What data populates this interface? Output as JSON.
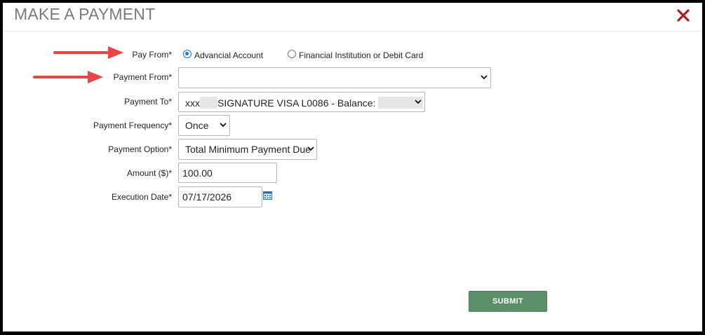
{
  "dialog": {
    "title": "MAKE A PAYMENT",
    "close_icon": "close-x-icon",
    "colors": {
      "close": "#b01c1c",
      "arrow": "#e84545",
      "radio_accent": "#1a73e8",
      "submit": "#5a8f6a"
    }
  },
  "form": {
    "pay_from": {
      "label": "Pay From*",
      "options": [
        {
          "label": "Advancial Account",
          "checked": true
        },
        {
          "label": "Financial Institution or Debit Card",
          "checked": false
        }
      ]
    },
    "payment_from": {
      "label": "Payment From*",
      "value": ""
    },
    "payment_to": {
      "label": "Payment To*",
      "value_prefix": "xxx",
      "value_main": "SIGNATURE VISA L0086 - Balance:"
    },
    "payment_frequency": {
      "label": "Payment Frequency*",
      "value": "Once"
    },
    "payment_option": {
      "label": "Payment Option*",
      "value": "Total Minimum Payment Due"
    },
    "amount": {
      "label": "Amount ($)*",
      "value": "100.00"
    },
    "execution_date": {
      "label": "Execution Date*",
      "value": "07/17/2026",
      "icon": "calendar-icon"
    },
    "submit_label": "SUBMIT"
  }
}
